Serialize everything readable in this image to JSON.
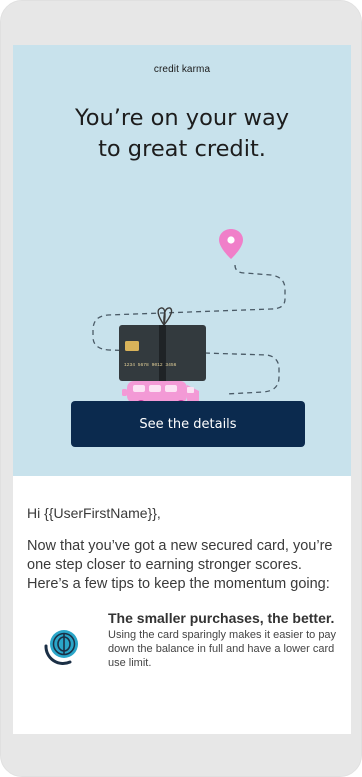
{
  "email": {
    "brand": "credit karma",
    "headline_line1": "You’re on your way",
    "headline_line2": "to great credit.",
    "cta_label": "See the details",
    "card_number_text": "1234 5678 9012 3456",
    "greeting": "Hi {{UserFirstName}},",
    "intro": "Now that you’ve got a new secured card, you’re one step closer to earning stronger scores. Here’s a few tips to keep the momentum going:",
    "tips": [
      {
        "title": "The smaller purchases, the better.",
        "description": "Using the card sparingly makes it easier to pay down the balance in full and have a lower card use limit."
      }
    ]
  },
  "icons": [
    "map-pin-icon",
    "gift-card-icon",
    "van-icon",
    "piggy-coin-icon"
  ],
  "colors": {
    "hero_background": "#c8e2ec",
    "cta_background": "#0b2a4e",
    "accent_pink": "#f07fc9",
    "teal_icon": "#2aa6c9",
    "frame": "#e7e7e7"
  }
}
